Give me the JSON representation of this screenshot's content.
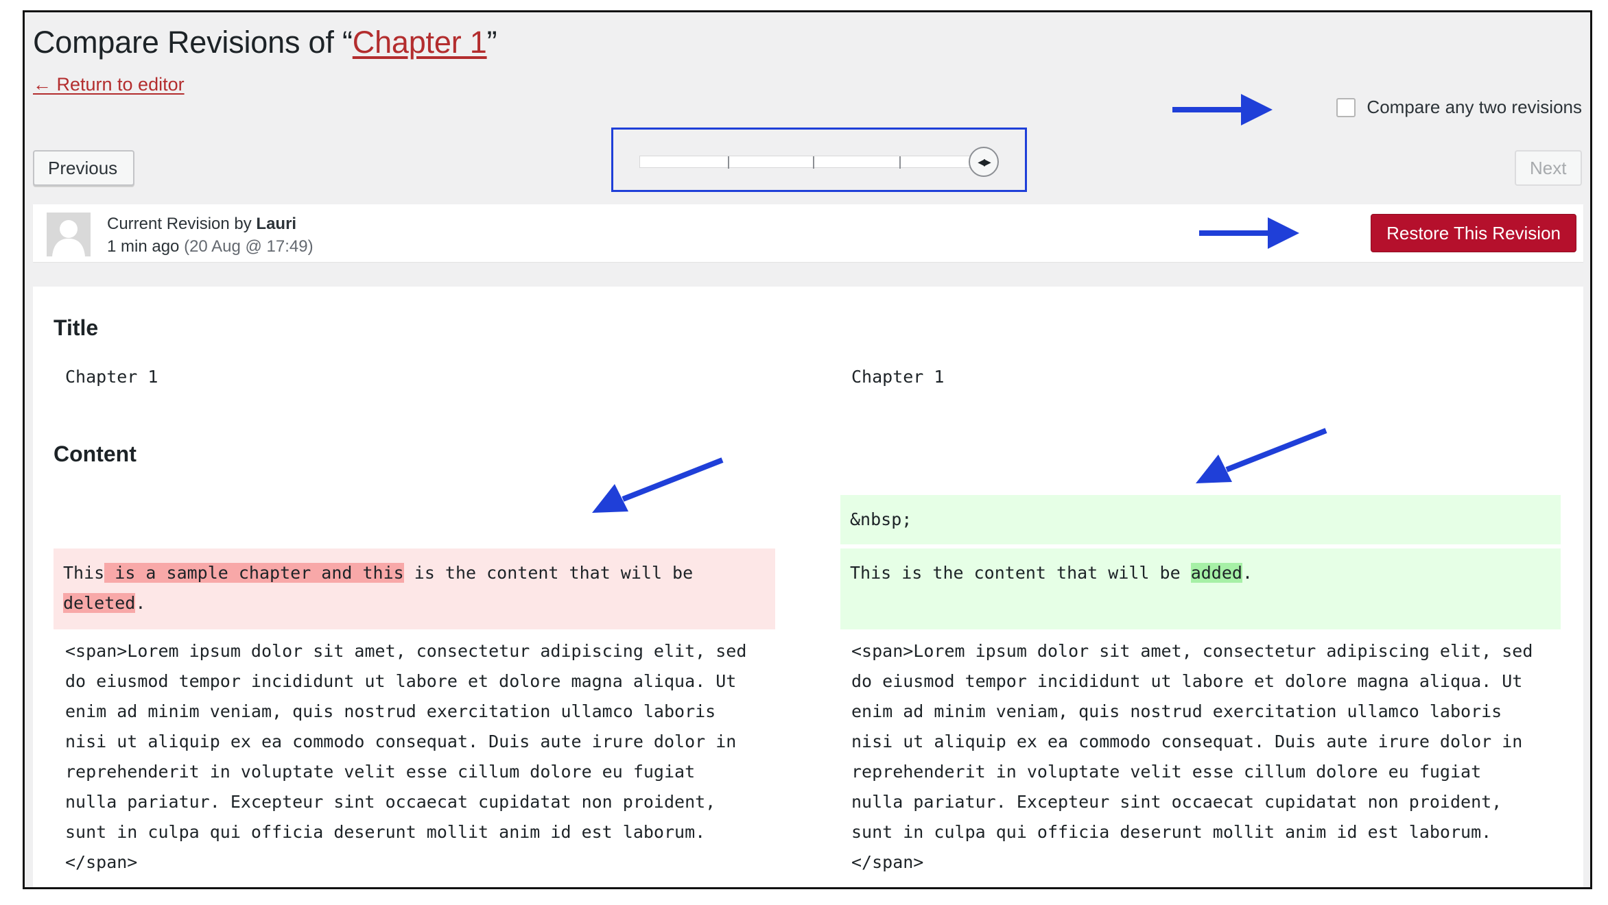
{
  "header": {
    "title_prefix": "Compare Revisions of “",
    "title_link": "Chapter 1",
    "title_suffix": "”",
    "return_link": "← Return to editor"
  },
  "compare_toggle": {
    "label": "Compare any two revisions",
    "checked": false
  },
  "nav": {
    "previous_label": "Previous",
    "next_label": "Next"
  },
  "slider": {
    "position": 1.0
  },
  "revision_meta": {
    "prefix": "Current Revision by ",
    "author": "Lauri",
    "time_ago": "1 min ago",
    "date": " (20 Aug @ 17:49)",
    "restore_label": "Restore This Revision"
  },
  "diff": {
    "title_heading": "Title",
    "left_title": "Chapter 1",
    "right_title": "Chapter 1",
    "content_heading": "Content",
    "right_nbsp": "&nbsp;",
    "left_changed": {
      "line1_a": "This",
      "line1_del": " is a sample chapter and this",
      "line1_b": " is the content that will be",
      "line2_del": "deleted",
      "line2_b": "."
    },
    "right_changed": {
      "line1_a": "This is the content that will be ",
      "line1_add": "added",
      "line1_b": "."
    },
    "lorem_lines": [
      "<span>Lorem ipsum dolor sit amet, consectetur adipiscing elit, sed",
      "do eiusmod tempor incididunt ut labore et dolore magna aliqua. Ut",
      "enim ad minim veniam, quis nostrud exercitation ullamco laboris",
      "nisi ut aliquip ex ea commodo consequat. Duis aute irure dolor in",
      "reprehenderit in voluptate velit esse cillum dolore eu fugiat",
      "nulla pariatur. Excepteur sint occaecat cupidatat non proident,",
      "sunt in culpa qui officia deserunt mollit anim id est laborum.",
      "</span>"
    ]
  },
  "colors": {
    "accent_red": "#b32d2e",
    "restore_button": "#b5102c",
    "annotation_blue": "#1f3fd8",
    "deleted_bg": "#fde7e7",
    "added_bg": "#e6ffe6"
  }
}
